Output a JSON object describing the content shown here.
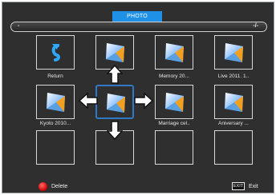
{
  "header": {
    "title": "PHOTO"
  },
  "path_bar": {
    "left_text": "-",
    "right_text": "-/-"
  },
  "grid": {
    "tiles": [
      {
        "label": "Return",
        "icon": "return-arrow-icon",
        "selected": false
      },
      {
        "label": "",
        "icon": "photo-thumbnail-icon",
        "selected": false
      },
      {
        "label": "Memory 20...",
        "icon": "photo-thumbnail-icon",
        "selected": false
      },
      {
        "label": "Live 2011. 1..",
        "icon": "photo-thumbnail-icon",
        "selected": false
      },
      {
        "label": "Kyoto 2010...",
        "icon": "photo-thumbnail-icon",
        "selected": false
      },
      {
        "label": "",
        "icon": "photo-thumbnail-icon",
        "selected": true
      },
      {
        "label": "Marriage cel..",
        "icon": "photo-thumbnail-icon",
        "selected": false
      },
      {
        "label": "Aniversary ...",
        "icon": "photo-thumbnail-icon",
        "selected": false
      },
      {
        "label": "",
        "icon": "",
        "selected": false
      },
      {
        "label": "",
        "icon": "",
        "selected": false
      },
      {
        "label": "",
        "icon": "",
        "selected": false
      },
      {
        "label": "",
        "icon": "",
        "selected": false
      }
    ]
  },
  "footer": {
    "delete_label": "Delete",
    "exit_key": "EXIT",
    "exit_label": "Exit"
  },
  "colors": {
    "background": "#2f2f2f",
    "accent": "#1e90e6",
    "selection": "#2f78c4",
    "delete_button": "#e00000"
  }
}
